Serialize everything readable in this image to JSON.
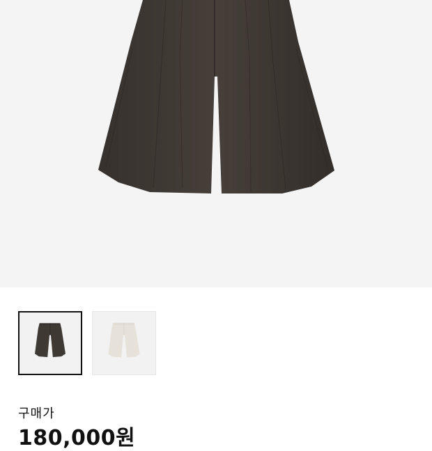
{
  "product": {
    "hero_image": "dark-brown-pleated-shorts",
    "colors": {
      "hero_background": "#f4f4f4",
      "dark_garment": "#3f3934",
      "light_garment": "#e6e2d9"
    },
    "thumbnails": [
      {
        "name": "dark-brown-shorts-thumbnail",
        "selected": true
      },
      {
        "name": "ivory-shorts-thumbnail",
        "selected": false
      }
    ],
    "price_label": "구매가",
    "price_value": "180,000원"
  }
}
